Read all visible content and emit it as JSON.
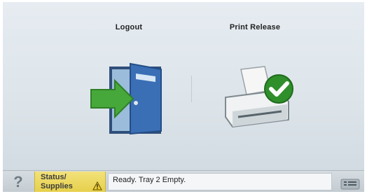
{
  "actions": {
    "logout_label": "Logout",
    "print_release_label": "Print Release"
  },
  "statusbar": {
    "help_label": "?",
    "status_line1": "Status/",
    "status_line2": "Supplies",
    "message": "Ready. Tray 2 Empty."
  },
  "icons": {
    "logout": "door-exit-icon",
    "print_release": "printer-check-icon",
    "warning": "warning-icon",
    "menu": "list-menu-icon"
  },
  "colors": {
    "status_button": "#e6cf4a",
    "arrow_green": "#46a83a",
    "door_blue": "#3a6fb5",
    "check_green": "#2f8f2b"
  }
}
